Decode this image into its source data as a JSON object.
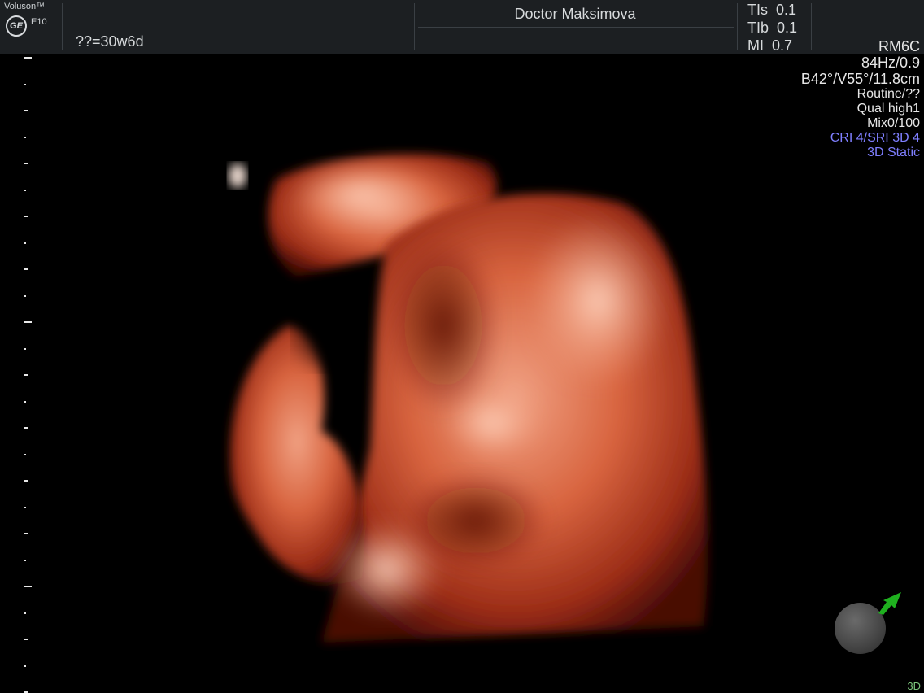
{
  "header": {
    "brand_name": "Voluson™",
    "logo_text": "GE",
    "model": "E10",
    "gestational_age": "??=30w6d",
    "doctor": "Doctor Maksimova",
    "indices": [
      {
        "label": "TIs",
        "value": "0.1"
      },
      {
        "label": "TIb",
        "value": "0.1"
      },
      {
        "label": "MI",
        "value": "0.7"
      }
    ]
  },
  "params": {
    "probe": "RM6C",
    "frequency": "84Hz/0.9",
    "angles": "B42°/V55°/11.8cm",
    "preset": "Routine/??",
    "quality": "Qual high1",
    "mix": "Mix0/100",
    "cri": "CRI 4/SRI 3D 4",
    "mode_label": "3D Static"
  },
  "footer": {
    "mode": "3D"
  },
  "colors": {
    "header_bg": "#1c1f22",
    "accent_blue": "#7f7fff",
    "arrow_green": "#1fb01f"
  }
}
